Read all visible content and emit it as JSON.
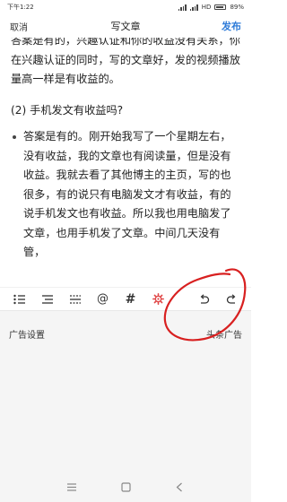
{
  "status_bar": {
    "time": "下午1:22",
    "network": "HD",
    "battery": "89%"
  },
  "header": {
    "cancel_label": "取消",
    "title": "写文章",
    "publish_label": "发布"
  },
  "article": {
    "paragraph_1": "答案是有的，兴趣认证和你的收益没有关系，你在兴趣认证的同时，写的文章好，发的视频播放量高一样是有收益的。",
    "heading_2": "(2) 手机发文有收益吗?",
    "bullet_1": "答案是有的。刚开始我写了一个星期左右，没有收益，我的文章也有阅读量，但是没有收益。我就去看了其他博主的主页，写的也很多，有的说只有电脑发文才有收益，有的说手机发文也有收益。所以我也用电脑发了文章，也用手机发了文章。中间几天没有管，"
  },
  "toolbar": {
    "at_symbol": "@",
    "hash_symbol": "#"
  },
  "ad_panel": {
    "settings_label": "广告设置",
    "option_label": "头条广告"
  },
  "colors": {
    "accent": "#2e7bd8",
    "settings_icon": "#e04848",
    "annotation": "#d82020"
  },
  "icons": {
    "list_bullet": "list-bullet-icon",
    "list_indent": "list-indent-icon",
    "divider": "divider-icon",
    "settings": "gear-icon",
    "undo": "undo-icon",
    "redo": "redo-icon"
  }
}
